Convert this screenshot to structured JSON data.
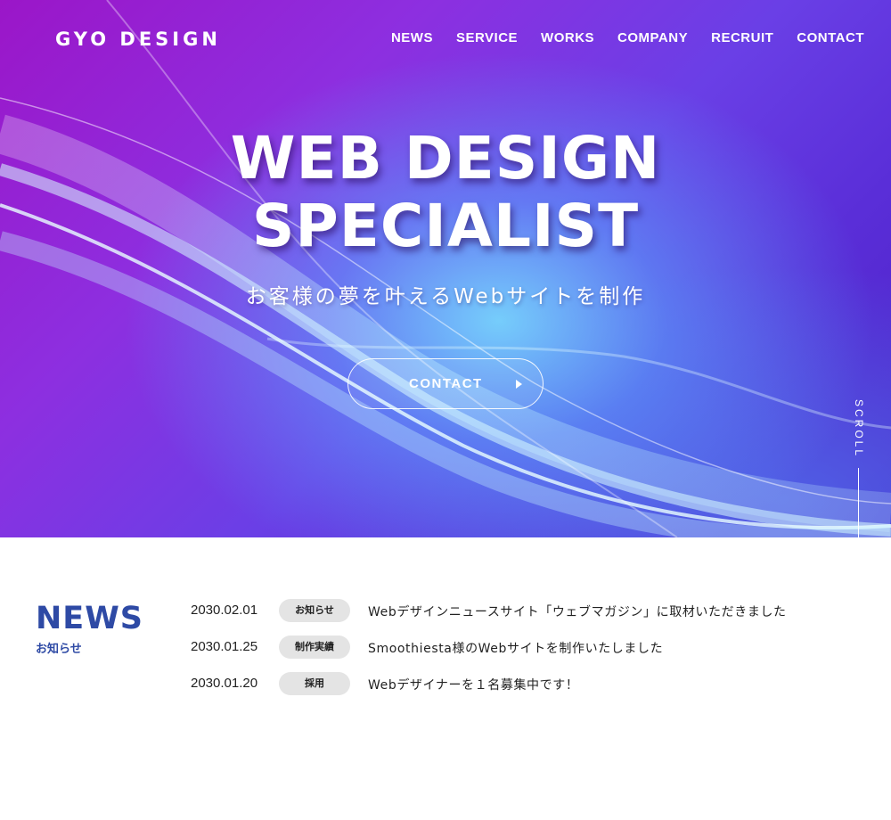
{
  "header": {
    "logo": "GYO DESIGN",
    "nav": [
      "NEWS",
      "SERVICE",
      "WORKS",
      "COMPANY",
      "RECRUIT",
      "CONTACT"
    ]
  },
  "hero": {
    "title_line1": "WEB DESIGN",
    "title_line2": "SPECIALIST",
    "subtitle": "お客様の夢を叶えるWebサイトを制作",
    "cta_label": "CONTACT",
    "scroll_label": "SCROLL"
  },
  "news": {
    "title": "NEWS",
    "subtitle": "お知らせ",
    "items": [
      {
        "date": "2030.02.01",
        "tag": "お知らせ",
        "text": "Webデザインニュースサイト「ウェブマガジン」に取材いただきました"
      },
      {
        "date": "2030.01.25",
        "tag": "制作実績",
        "text": "Smoothiesta様のWebサイトを制作いたしました"
      },
      {
        "date": "2030.01.20",
        "tag": "採用",
        "text": "Webデザイナーを１名募集中です！"
      }
    ]
  },
  "colors": {
    "accent": "#2e4aa5",
    "hero_gradient_start": "#9b16c8",
    "hero_gradient_end": "#4b1fc4",
    "tag_background": "#e4e4e4"
  }
}
